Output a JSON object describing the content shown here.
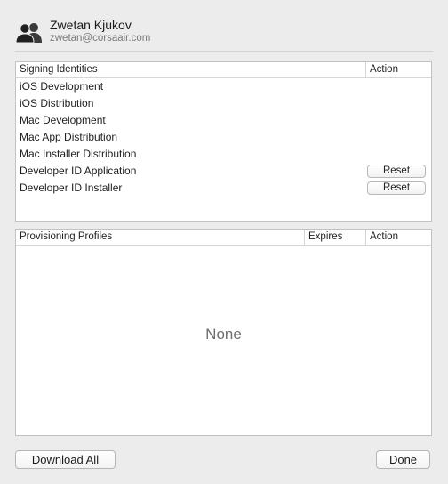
{
  "account": {
    "name": "Zwetan Kjukov",
    "email": "zwetan@corsaair.com",
    "icon": "people-icon"
  },
  "signing_identities": {
    "columns": [
      "Signing Identities",
      "Action"
    ],
    "rows": [
      {
        "name": "iOS Development",
        "action": ""
      },
      {
        "name": "iOS Distribution",
        "action": ""
      },
      {
        "name": "Mac Development",
        "action": ""
      },
      {
        "name": "Mac App Distribution",
        "action": ""
      },
      {
        "name": "Mac Installer Distribution",
        "action": ""
      },
      {
        "name": "Developer ID Application",
        "action": "Reset"
      },
      {
        "name": "Developer ID Installer",
        "action": "Reset"
      }
    ]
  },
  "provisioning_profiles": {
    "columns": [
      "Provisioning Profiles",
      "Expires",
      "Action"
    ],
    "empty_text": "None"
  },
  "buttons": {
    "download_all": "Download All",
    "done": "Done"
  }
}
